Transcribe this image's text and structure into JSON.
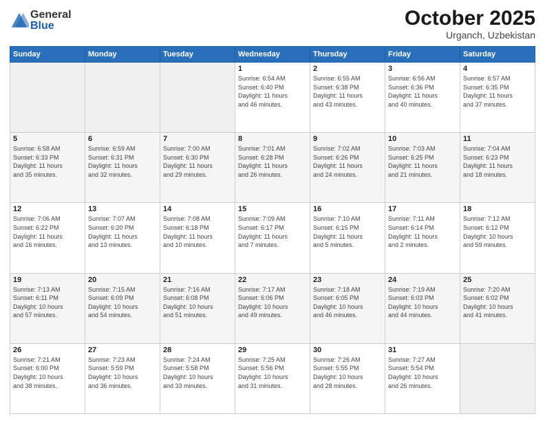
{
  "header": {
    "logo_general": "General",
    "logo_blue": "Blue",
    "month": "October 2025",
    "location": "Urganch, Uzbekistan"
  },
  "days_of_week": [
    "Sunday",
    "Monday",
    "Tuesday",
    "Wednesday",
    "Thursday",
    "Friday",
    "Saturday"
  ],
  "weeks": [
    [
      {
        "day": "",
        "info": ""
      },
      {
        "day": "",
        "info": ""
      },
      {
        "day": "",
        "info": ""
      },
      {
        "day": "1",
        "info": "Sunrise: 6:54 AM\nSunset: 6:40 PM\nDaylight: 11 hours\nand 46 minutes."
      },
      {
        "day": "2",
        "info": "Sunrise: 6:55 AM\nSunset: 6:38 PM\nDaylight: 11 hours\nand 43 minutes."
      },
      {
        "day": "3",
        "info": "Sunrise: 6:56 AM\nSunset: 6:36 PM\nDaylight: 11 hours\nand 40 minutes."
      },
      {
        "day": "4",
        "info": "Sunrise: 6:57 AM\nSunset: 6:35 PM\nDaylight: 11 hours\nand 37 minutes."
      }
    ],
    [
      {
        "day": "5",
        "info": "Sunrise: 6:58 AM\nSunset: 6:33 PM\nDaylight: 11 hours\nand 35 minutes."
      },
      {
        "day": "6",
        "info": "Sunrise: 6:59 AM\nSunset: 6:31 PM\nDaylight: 11 hours\nand 32 minutes."
      },
      {
        "day": "7",
        "info": "Sunrise: 7:00 AM\nSunset: 6:30 PM\nDaylight: 11 hours\nand 29 minutes."
      },
      {
        "day": "8",
        "info": "Sunrise: 7:01 AM\nSunset: 6:28 PM\nDaylight: 11 hours\nand 26 minutes."
      },
      {
        "day": "9",
        "info": "Sunrise: 7:02 AM\nSunset: 6:26 PM\nDaylight: 11 hours\nand 24 minutes."
      },
      {
        "day": "10",
        "info": "Sunrise: 7:03 AM\nSunset: 6:25 PM\nDaylight: 11 hours\nand 21 minutes."
      },
      {
        "day": "11",
        "info": "Sunrise: 7:04 AM\nSunset: 6:23 PM\nDaylight: 11 hours\nand 18 minutes."
      }
    ],
    [
      {
        "day": "12",
        "info": "Sunrise: 7:06 AM\nSunset: 6:22 PM\nDaylight: 11 hours\nand 16 minutes."
      },
      {
        "day": "13",
        "info": "Sunrise: 7:07 AM\nSunset: 6:20 PM\nDaylight: 11 hours\nand 13 minutes."
      },
      {
        "day": "14",
        "info": "Sunrise: 7:08 AM\nSunset: 6:18 PM\nDaylight: 11 hours\nand 10 minutes."
      },
      {
        "day": "15",
        "info": "Sunrise: 7:09 AM\nSunset: 6:17 PM\nDaylight: 11 hours\nand 7 minutes."
      },
      {
        "day": "16",
        "info": "Sunrise: 7:10 AM\nSunset: 6:15 PM\nDaylight: 11 hours\nand 5 minutes."
      },
      {
        "day": "17",
        "info": "Sunrise: 7:11 AM\nSunset: 6:14 PM\nDaylight: 11 hours\nand 2 minutes."
      },
      {
        "day": "18",
        "info": "Sunrise: 7:12 AM\nSunset: 6:12 PM\nDaylight: 10 hours\nand 59 minutes."
      }
    ],
    [
      {
        "day": "19",
        "info": "Sunrise: 7:13 AM\nSunset: 6:11 PM\nDaylight: 10 hours\nand 57 minutes."
      },
      {
        "day": "20",
        "info": "Sunrise: 7:15 AM\nSunset: 6:09 PM\nDaylight: 10 hours\nand 54 minutes."
      },
      {
        "day": "21",
        "info": "Sunrise: 7:16 AM\nSunset: 6:08 PM\nDaylight: 10 hours\nand 51 minutes."
      },
      {
        "day": "22",
        "info": "Sunrise: 7:17 AM\nSunset: 6:06 PM\nDaylight: 10 hours\nand 49 minutes."
      },
      {
        "day": "23",
        "info": "Sunrise: 7:18 AM\nSunset: 6:05 PM\nDaylight: 10 hours\nand 46 minutes."
      },
      {
        "day": "24",
        "info": "Sunrise: 7:19 AM\nSunset: 6:03 PM\nDaylight: 10 hours\nand 44 minutes."
      },
      {
        "day": "25",
        "info": "Sunrise: 7:20 AM\nSunset: 6:02 PM\nDaylight: 10 hours\nand 41 minutes."
      }
    ],
    [
      {
        "day": "26",
        "info": "Sunrise: 7:21 AM\nSunset: 6:00 PM\nDaylight: 10 hours\nand 38 minutes."
      },
      {
        "day": "27",
        "info": "Sunrise: 7:23 AM\nSunset: 5:59 PM\nDaylight: 10 hours\nand 36 minutes."
      },
      {
        "day": "28",
        "info": "Sunrise: 7:24 AM\nSunset: 5:58 PM\nDaylight: 10 hours\nand 33 minutes."
      },
      {
        "day": "29",
        "info": "Sunrise: 7:25 AM\nSunset: 5:56 PM\nDaylight: 10 hours\nand 31 minutes."
      },
      {
        "day": "30",
        "info": "Sunrise: 7:26 AM\nSunset: 5:55 PM\nDaylight: 10 hours\nand 28 minutes."
      },
      {
        "day": "31",
        "info": "Sunrise: 7:27 AM\nSunset: 5:54 PM\nDaylight: 10 hours\nand 26 minutes."
      },
      {
        "day": "",
        "info": ""
      }
    ]
  ]
}
